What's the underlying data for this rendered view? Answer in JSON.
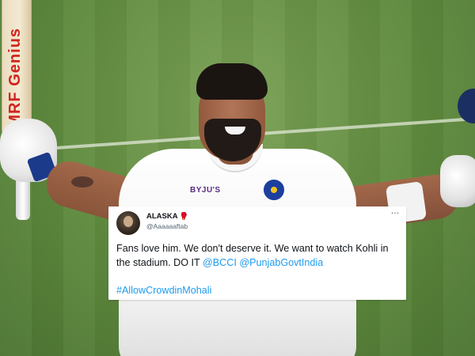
{
  "bat": {
    "brand_text": "MRF Genius"
  },
  "jersey": {
    "sponsor": "BYJU'S"
  },
  "tweet": {
    "display_name": "ALASKA",
    "name_emoji": "🥊",
    "handle": "@Aaaaaaftab",
    "more_icon": "more-horizontal-icon",
    "text_part1": "Fans love him. We don't deserve it. We want to watch Kohli in the stadium. DO IT ",
    "mentions": [
      "@BCCI",
      "@PunjabGovtIndia"
    ],
    "hashtag": "#AllowCrowdinMohali",
    "link_color": "#1d9bf0"
  }
}
